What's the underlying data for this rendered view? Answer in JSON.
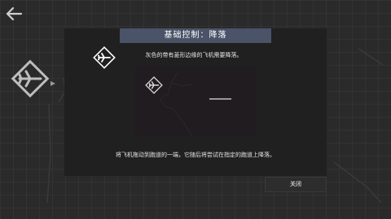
{
  "dialog": {
    "title": "基础控制：降落",
    "description_top": "灰色的带有菱形边缘的飞机需要降落。",
    "description_bottom": "将飞机拖动到跑道的一端，它随后将尝试在指定的跑道上降落。",
    "close_label": "关闭"
  },
  "icons": {
    "back": "back-arrow-icon",
    "airplane": "airplane-diamond-icon"
  },
  "colors": {
    "background": "#2a2a2a",
    "modal": "#202020",
    "title_bar": "#4a5368",
    "preview_map": "#211c1f",
    "close_button": "#2d2d2d"
  }
}
